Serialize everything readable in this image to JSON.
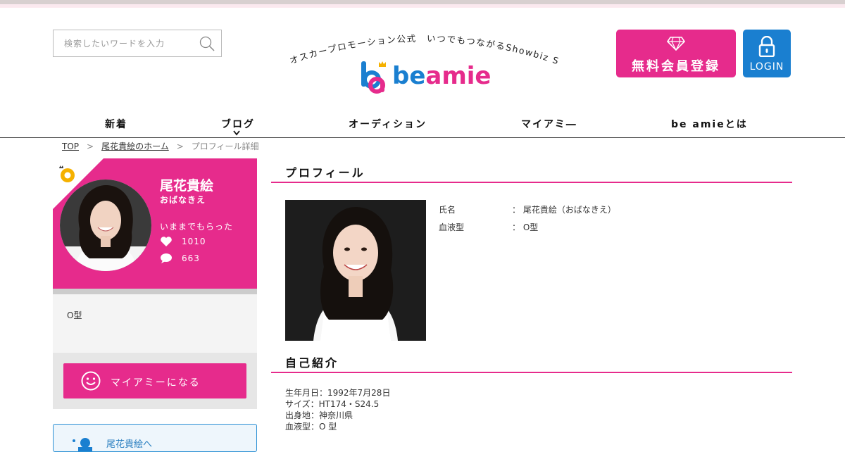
{
  "header": {
    "search_placeholder": "検索したいワードを入力",
    "tagline": "オスカープロモーション公式　いつでもつながるShowbiz SNS",
    "logo_text": "beamie",
    "register_label": "無料会員登録",
    "login_label": "LOGIN"
  },
  "nav": {
    "items": [
      "新着",
      "ブログ",
      "オーディション",
      "マイアミ―",
      "be amieとは"
    ]
  },
  "breadcrumb": {
    "top": "TOP",
    "home": "尾花貴絵のホーム",
    "current": "プロフィール詳細",
    "sep": ">"
  },
  "sidebar": {
    "name": "尾花貴絵",
    "kana": "おばなきえ",
    "received_label": "いままでもらった",
    "likes": "1010",
    "comments": "663",
    "blood_text": "O型",
    "mymi_label": "マイアミーになる",
    "to_home_label": "尾花貴絵へ"
  },
  "main": {
    "profile_heading": "プロフィール",
    "profile_rows": [
      {
        "key": "氏名",
        "value": "：  尾花貴絵（おばなきえ）"
      },
      {
        "key": "血液型",
        "value": "：  O型"
      }
    ],
    "intro_heading": "自己紹介",
    "intro_lines": [
      "生年月日：1992年7月28日",
      "サイズ：HT174・S24.5",
      "出身地：神奈川県",
      "血液型：O 型"
    ]
  },
  "colors": {
    "brand_pink": "#e62b8c",
    "brand_blue": "#1a7fd0",
    "badge_yellow": "#f5b100"
  }
}
